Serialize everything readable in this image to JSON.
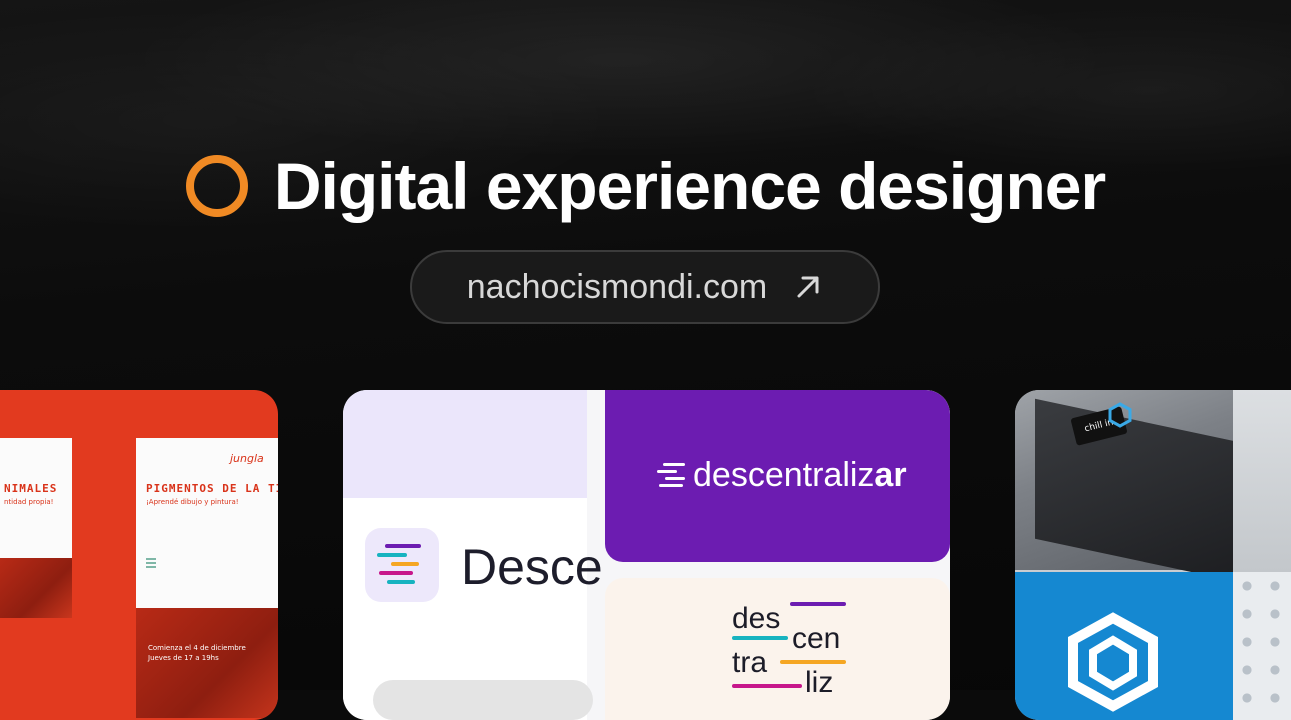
{
  "hero": {
    "title": "Digital experience designer"
  },
  "link": {
    "text": "nachocismondi.com"
  },
  "left_card": {
    "poster_left_title": "NIMALES",
    "poster_left_sub": "ntidad propia!",
    "poster_logo": "jungla",
    "poster_right_title": "PIGMENTOS DE LA TIERRA",
    "poster_right_sub": "¡Aprendé dibujo y pintura!",
    "poster_caption_1": "Comienza el 4 de diciembre",
    "poster_caption_2": "Jueves de 17 a 19hs"
  },
  "center_card": {
    "app_name": "Desce",
    "brand_prefix": "descentraliz",
    "brand_suffix": "ar",
    "stack_1": "des",
    "stack_2": "cen",
    "stack_3": "tra",
    "stack_4": "liz",
    "colors": {
      "purple": "#6c1cb1",
      "teal": "#17b3c0",
      "orange": "#f5a623",
      "magenta": "#c7178b"
    }
  },
  "right_card": {
    "device_label": "chill in",
    "side_label": "chill in"
  },
  "accent_color": "#f08a24"
}
